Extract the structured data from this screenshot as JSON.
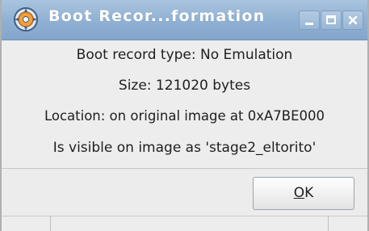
{
  "window": {
    "title": "Boot Recor...formation",
    "title_icon": "gear-disc-icon"
  },
  "window_controls": {
    "minimize_icon": "minimize-icon",
    "maximize_icon": "maximize-icon",
    "close_icon": "close-icon"
  },
  "info": {
    "type_line": "Boot record type: No Emulation",
    "size_line": "Size: 121020 bytes",
    "location_line": "Location: on original image at 0xA7BE000",
    "visible_line": "Is visible on image as 'stage2_eltorito'"
  },
  "buttons": {
    "ok_mnemonic": "O",
    "ok_rest": "K"
  },
  "colors": {
    "titlebar": "#8fb0d2",
    "dialog_background": "#ededed",
    "text": "#1e1e1e"
  }
}
